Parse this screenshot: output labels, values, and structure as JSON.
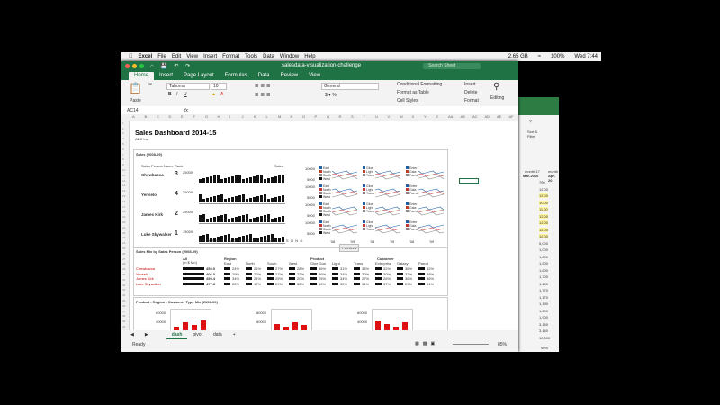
{
  "mac_menu": {
    "app": "Excel",
    "items": [
      "File",
      "Edit",
      "View",
      "Insert",
      "Format",
      "Tools",
      "Data",
      "Window",
      "Help"
    ],
    "status": [
      "2.65 GB",
      "100%",
      "Wed 7:44"
    ]
  },
  "window": {
    "title": "salesdata-visualization-challenge",
    "search_placeholder": "Search Sheet",
    "ribbon_tabs": [
      "Home",
      "Insert",
      "Page Layout",
      "Formulas",
      "Data",
      "Review",
      "View"
    ],
    "active_tab": "Home"
  },
  "ribbon": {
    "paste": "Paste",
    "font_name": "Tahoma",
    "font_size": "10",
    "number_format": "General",
    "conditional_formatting": "Conditional Formatting",
    "format_as_table": "Format as Table",
    "cell_styles": "Cell Styles",
    "insert": "Insert",
    "delete": "Delete",
    "format": "Format",
    "editing": "Editing"
  },
  "formula_bar": {
    "name_box": "AC14",
    "fx": "fx",
    "value": ""
  },
  "columns": [
    "A",
    "B",
    "C",
    "D",
    "E",
    "F",
    "G",
    "H",
    "I",
    "J",
    "K",
    "L",
    "M",
    "N",
    "O",
    "P",
    "Q",
    "R",
    "S",
    "T",
    "U",
    "V",
    "W",
    "X",
    "Y",
    "Z",
    "AA",
    "AB",
    "AC",
    "AD",
    "AE",
    "AF"
  ],
  "dashboard": {
    "title": "Sales Dashboard 2014-15",
    "company": "ABC Inc.",
    "sales_title": "Sales (2008-09)",
    "col_salesperson": "Sales Person Name",
    "col_rank": "Rank",
    "sales_legend": "Sales",
    "people": [
      {
        "name": "Chewbacca",
        "rank": "3",
        "axis": "25000"
      },
      {
        "name": "Yenselo",
        "rank": "4",
        "axis": "25000"
      },
      {
        "name": "James Kirk",
        "rank": "2",
        "axis": "25000"
      },
      {
        "name": "Luke Skywalker",
        "rank": "1",
        "axis": "15000"
      }
    ],
    "y_ticks": [
      "25000",
      "10000",
      "15000"
    ],
    "months": "J F M A M J J A S O N D J F M A M J J A S O N D",
    "mini_axis": [
      "10000",
      "5000"
    ],
    "mini_legend": [
      [
        "East",
        "North",
        "South",
        "West"
      ],
      [
        "Glue",
        "Light",
        "Trans"
      ],
      [
        "Enter",
        "Gala",
        "Parrot"
      ]
    ],
    "x_years": [
      "'08",
      "'09",
      "'08",
      "'09",
      "'08",
      "'09"
    ],
    "tooltip": "Plot Area",
    "mix_title": "Sales Mix by Sales Person (2008-09)",
    "mix_headers": {
      "all": "All",
      "all_sub": "(in $ Mn)",
      "region": "Region",
      "regions": [
        "East",
        "North",
        "South",
        "West"
      ],
      "product": "Product",
      "products": [
        "Glue Gun",
        "Light",
        "Trans"
      ],
      "customer": "Customer",
      "customers": [
        "Enterprise",
        "Galaxy",
        "Parrot"
      ]
    },
    "mix_rows": [
      {
        "name": "Chewbacca",
        "all": "459.0",
        "vals": [
          "24%",
          "21%",
          "27%",
          "28%",
          "36%",
          "31%",
          "33%",
          "32%",
          "36%",
          "32%"
        ]
      },
      {
        "name": "Yenselo",
        "all": "406.0",
        "vals": [
          "29%",
          "22%",
          "27%",
          "22%",
          "36%",
          "34%",
          "30%",
          "30%",
          "32%",
          "38%"
        ]
      },
      {
        "name": "James Kirk",
        "all": "459.4",
        "vals": [
          "34%",
          "21%",
          "25%",
          "20%",
          "25%",
          "34%",
          "27%",
          "26%",
          "36%",
          "36%"
        ]
      },
      {
        "name": "Luke Skywalker",
        "all": "477.8",
        "vals": [
          "22%",
          "17%",
          "29%",
          "32%",
          "36%",
          "30%",
          "34%",
          "37%",
          "29%",
          "34%"
        ]
      }
    ],
    "prc_title": "Product - Region - Customer Type Mix (2008-09)",
    "prc_axis": [
      "60000",
      "80000",
      "60000"
    ],
    "prc_axis2": [
      "40000",
      "60000",
      "40000"
    ]
  },
  "sheet_tabs": [
    "dash",
    "pivot",
    "data"
  ],
  "active_sheet": "dash",
  "status": {
    "ready": "Ready",
    "zoom": "85%",
    "back_zoom": "90%"
  },
  "back_window": {
    "labels": [
      "Sort &",
      "Filter"
    ],
    "month_headers": [
      "month 17",
      "month"
    ],
    "date_headers": [
      "Mar-2016",
      "Apr-20"
    ],
    "values": [
      "790",
      "12.00",
      "12.00",
      "10.00",
      "11.00",
      "12.00",
      "12.00",
      "12.00",
      "12.00",
      "5,000",
      "1,000",
      "1,800",
      "1,500",
      "1,600",
      "1,700",
      "1,100",
      "1,770",
      "1,170",
      "1,190",
      "1,600",
      "1,900",
      "3,150",
      "3,150",
      "10,000"
    ]
  },
  "colors": {
    "excel_green": "#1f7244",
    "accent_red": "#c00000",
    "bar_black": "#111111"
  }
}
